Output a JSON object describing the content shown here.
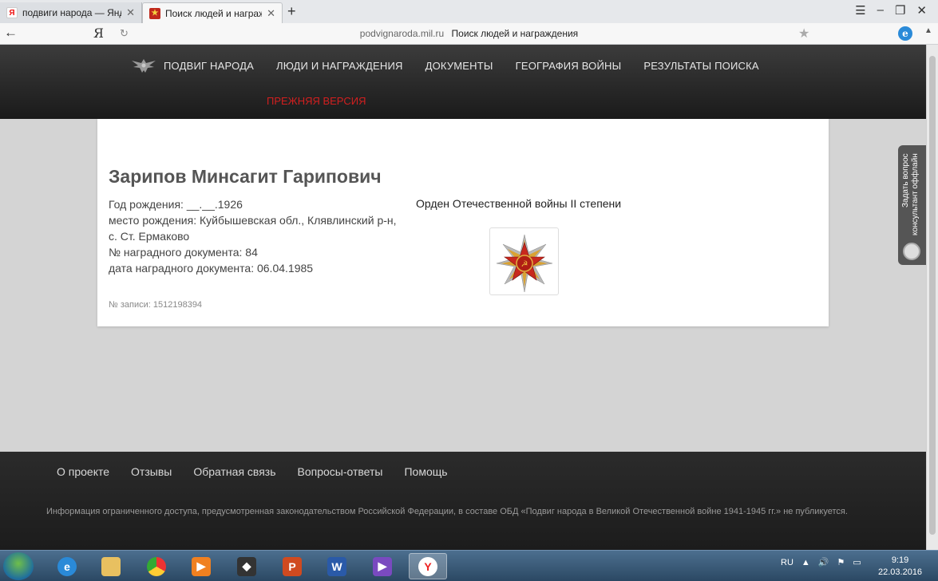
{
  "browser": {
    "tabs": [
      {
        "title": "подвиги народа — Яндекс: н",
        "favicon": "yandex-icon"
      },
      {
        "title": "Поиск людей и награжде",
        "favicon": "podvig-icon"
      }
    ],
    "new_tab": "+",
    "url_domain": "podvignaroda.mil.ru",
    "url_title": "Поиск людей и награждения",
    "yandex_button": "Я"
  },
  "site": {
    "nav": [
      "ПОДВИГ НАРОДА",
      "ЛЮДИ И НАГРАЖДЕНИЯ",
      "ДОКУМЕНТЫ",
      "ГЕОГРАФИЯ ВОЙНЫ",
      "РЕЗУЛЬТАТЫ ПОИСКА"
    ],
    "prev_version": "ПРЕЖНЯЯ ВЕРСИЯ",
    "accent_color": "#d21f1f"
  },
  "person": {
    "name": "Зарипов Минсагит Гарипович",
    "birth_year": "Год рождения: __.__.1926",
    "birth_place": "место рождения: Куйбышевская обл., Клявлинский р-н, с. Ст. Ермаково",
    "doc_number": "№ наградного документа: 84",
    "doc_date": "дата наградного документа: 06.04.1985",
    "record": "№ записи: 1512198394"
  },
  "award": {
    "name": "Орден Отечественной войны II степени",
    "image": "order-patriotic-war-medal"
  },
  "feedback": {
    "line1": "Задать вопрос",
    "line2": "консультант оффлайн"
  },
  "footer": {
    "links": [
      "О проекте",
      "Отзывы",
      "Обратная связь",
      "Вопросы-ответы",
      "Помощь"
    ],
    "info": "Информация ограниченного доступа, предусмотренная законодательством Российской Федерации, в составе ОБД «Подвиг народа в Великой Отечественной войне 1941-1945 гг.» не публикуется."
  },
  "taskbar": {
    "language": "RU",
    "time": "9:19",
    "date": "22.03.2016"
  }
}
